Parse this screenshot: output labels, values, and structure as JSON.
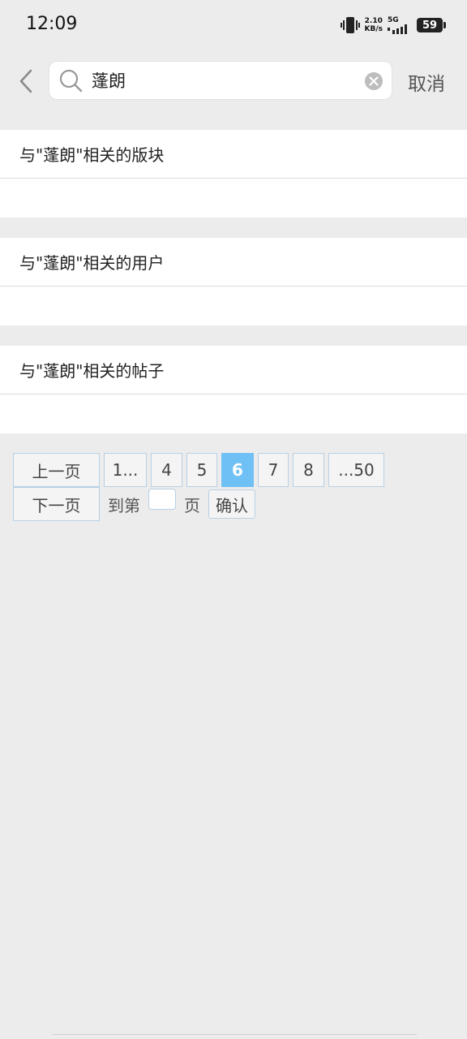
{
  "status": {
    "time": "12:09",
    "net_speed_value": "2.10",
    "net_speed_unit": "KB/s",
    "network": "5G",
    "battery": "59"
  },
  "search": {
    "value": "蓬朗",
    "cancel_label": "取消"
  },
  "sections": [
    {
      "title": "与\"蓬朗\"相关的版块"
    },
    {
      "title": "与\"蓬朗\"相关的用户"
    },
    {
      "title": "与\"蓬朗\"相关的帖子"
    }
  ],
  "pager": {
    "prev_label": "上一页",
    "first": "1...",
    "pages": [
      "4",
      "5",
      "6",
      "7",
      "8"
    ],
    "current": "6",
    "last": "...50",
    "next_label": "下一页",
    "goto_prefix": "到第",
    "goto_suffix": "页",
    "confirm_label": "确认"
  }
}
